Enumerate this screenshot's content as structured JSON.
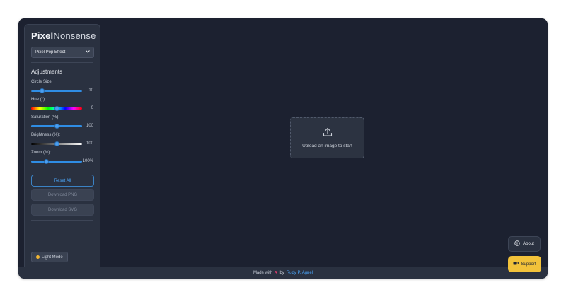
{
  "app": {
    "logo_bold": "Pixel",
    "logo_light": "Nonsense"
  },
  "effect": {
    "selected": "Pixel Pop Effect"
  },
  "adjustments": {
    "title": "Adjustments",
    "controls": [
      {
        "label": "Circle Size:",
        "value": "10",
        "level": 0.22
      },
      {
        "label": "Hue (°):",
        "value": "0",
        "level": 0.5
      },
      {
        "label": "Saturation (%):",
        "value": "100",
        "level": 0.5
      },
      {
        "label": "Brightness (%):",
        "value": "100",
        "level": 0.5
      },
      {
        "label": "Zoom (%):",
        "value": "100%",
        "level": 0.3
      }
    ]
  },
  "buttons": {
    "reset": "Reset All",
    "download_png": "Download PNG",
    "download_svg": "Download SVG",
    "theme": "Light Mode"
  },
  "upload": {
    "text": "Upload an image to start"
  },
  "footer": {
    "made_with": "Made with",
    "by": "by",
    "author": "Rudy P. Agnel"
  },
  "floating": {
    "about": "About",
    "support": "Support"
  },
  "colors": {
    "background": "#1c2130",
    "panel": "#2a3140",
    "accent": "#2f8de4",
    "support": "#f2c23a"
  }
}
